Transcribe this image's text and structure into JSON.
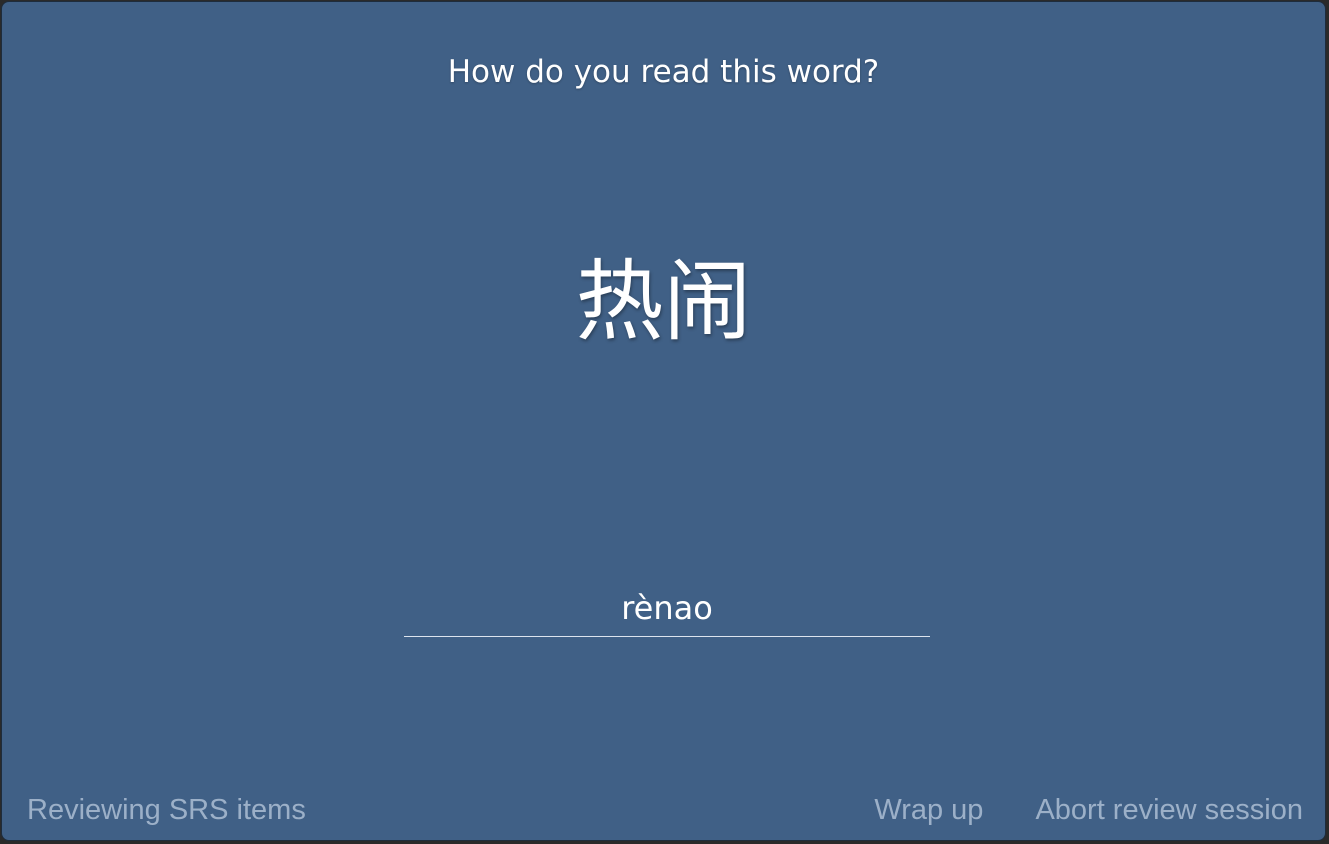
{
  "review": {
    "prompt": "How do you read this word?",
    "word": "热闹",
    "answer_value": "rènao"
  },
  "footer": {
    "status": "Reviewing SRS items",
    "wrap_up_label": "Wrap up",
    "abort_label": "Abort review session"
  },
  "colors": {
    "card_background": "#406086",
    "text": "#ffffff",
    "footer_text": "#9cb0c8"
  }
}
